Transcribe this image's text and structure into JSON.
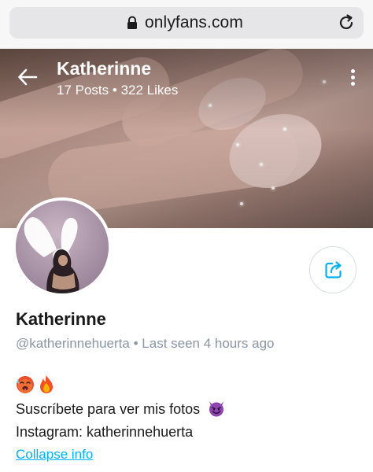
{
  "browser": {
    "url": "onlyfans.com",
    "icons": {
      "lock": "lock-icon",
      "reload": "reload-icon"
    }
  },
  "header": {
    "title": "Katherinne",
    "posts": "17 Posts",
    "separator": "•",
    "likes": "322 Likes",
    "icons": {
      "back": "arrow-left-icon",
      "more": "more-vertical-icon"
    }
  },
  "profile": {
    "name": "Katherinne",
    "handle": "@katherinnehuerta",
    "separator": "•",
    "last_seen": "Last seen 4 hours ago",
    "share_icon": "share-icon"
  },
  "bio": {
    "emojis": [
      "hot-face-emoji",
      "fire-emoji"
    ],
    "line1": "Suscríbete para ver mis fotos",
    "line1_emoji": "smiling-devil-emoji",
    "line2": "Instagram: katherinnehuerta"
  },
  "actions": {
    "collapse_label": "Collapse info"
  },
  "colors": {
    "accent": "#00aff0",
    "muted_text": "#8a96a3",
    "devil_purple": "#8e44ad"
  }
}
